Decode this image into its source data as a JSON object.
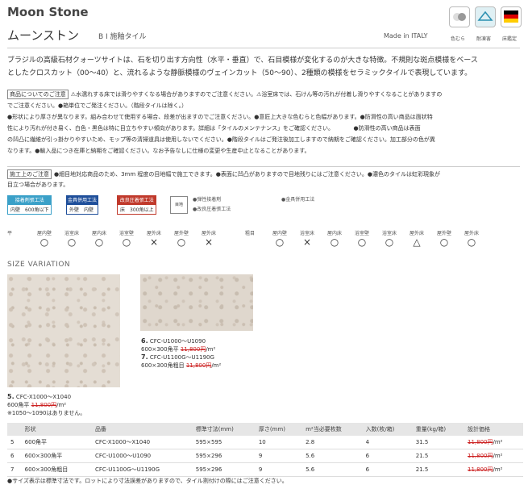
{
  "header": {
    "title": "Moon Stone",
    "subtitle": "ムーンストン",
    "series": "B I 施釉タイル",
    "made_in": "Made in ITALY",
    "badges": [
      {
        "icon": "color-variation-icon",
        "label": "色むら"
      },
      {
        "icon": "weather-resistant-icon",
        "label": "耐凍害"
      },
      {
        "icon": "german-flag-icon",
        "label": "床鑑定"
      }
    ]
  },
  "description": {
    "line1": "ブラジルの高級石材クォーツサイトは、石を切り出す方向性（水平・垂直）で、石目模様が変化するのが大きな特徴。不規則な斑点模様をベース",
    "line2": "としたクロスカット（00～40）と、流れるような静脈模様のヴェインカット（50～90）、2種類の模様をセラミックタイルで表現しています。"
  },
  "notes": {
    "heading": "商品についてのご注意",
    "lines": [
      "⚠水濡れする床では滑りやすくなる場合がありますのでご注意ください。⚠浴室床では、石けん等の汚れが付着し滑りやすくなることがありますの",
      "でご注意ください。●箱単位でご発注ください。（階段タイルは除く。）",
      "●形状により厚さが異なります。組み合わせて使用する場合、段差が出ますのでご注意ください。●意匠上大きな色むらと色幅があります。●防滑性の高い商品は面状特",
      "性により汚れが付き易く、白色・黒色は特に目立ちやすい傾向があります。詳細は「タイルのメンテナンス」をご確認ください。　　　　●防滑性の高い商品は表面",
      "の凹凸に繊維が引っ掛かりやすいため、モップ等の清掃道具は使用しないでください。●階段タイルはご発注後加工しますので納期をご確認ください。加工部分の色が異",
      "なります。●輸入品につき在庫と納期をご確認ください。なお予告なしに仕様の変更や生産中止となることがあります。"
    ]
  },
  "construction": {
    "heading": "施工上のご注意",
    "lines": [
      "●細目地対応商品のため、3mm 程度の目地幅で施工できます。●表面に凹凸がありますので目地残りにはご注意ください。●濃色のタイルは虹彩現象が",
      "目立つ場合があります。"
    ]
  },
  "methods": [
    {
      "head": "接着剤張工法",
      "left": "内壁",
      "right": "600角以下",
      "color": "#3aa0c8"
    },
    {
      "head": "金具併用工法",
      "left": "外壁",
      "right": "内壁",
      "color": "#1f4f9a"
    },
    {
      "head": "改良圧着張工法",
      "left": "床",
      "right": "300角以上",
      "color": "#c0392b"
    }
  ],
  "method_icon_label": "目地",
  "method_options": [
    "●弾性接着剤",
    "●改良圧着張工法",
    "●金具併用工法"
  ],
  "usage": {
    "row_label_a": "平",
    "row_label_b": "粗目",
    "headers": [
      "屋内壁",
      "浴室床",
      "屋内床",
      "浴室壁",
      "屋外床",
      "屋外壁",
      "屋外床"
    ],
    "marks_a": [
      "○",
      "○",
      "○",
      "○",
      "×",
      "○",
      "×"
    ],
    "headers_b": [
      "屋内壁",
      "浴室床",
      "屋内床",
      "浴室壁",
      "浴室床",
      "屋外床",
      "屋外壁",
      "屋外床"
    ],
    "marks_b": [
      "○",
      "×",
      "○",
      "○",
      "○",
      "△",
      "○",
      "○"
    ]
  },
  "size_variation": {
    "heading": "SIZE VARIATION",
    "item5": {
      "num": "5.",
      "code": "CFC-X1000～X1040",
      "size": "600角平",
      "price": "11,800円",
      "unit": "/m²",
      "note": "※1050～1090はありません。"
    },
    "item6": {
      "num": "6.",
      "code": "CFC-U1000～U1090",
      "size": "600×300角平",
      "price": "11,800円",
      "unit": "/m²"
    },
    "item7": {
      "num": "7.",
      "code": "CFC-U1100G～U1190G",
      "size": "600×300角粗目",
      "price": "11,800円",
      "unit": "/m²"
    }
  },
  "table": {
    "headers": [
      "",
      "形状",
      "品番",
      "標準寸法(mm)",
      "厚さ(mm)",
      "m²当必要枚数",
      "入数(枚/箱)",
      "重量(kg/箱)",
      "設計価格"
    ],
    "rows": [
      [
        "5",
        "600角平",
        "CFC-X1000～X1040",
        "595×595",
        "10",
        "2.8",
        "4",
        "31.5",
        "11,800円",
        "/m²"
      ],
      [
        "6",
        "600×300角平",
        "CFC-U1000～U1090",
        "595×296",
        "9",
        "5.6",
        "6",
        "21.5",
        "11,800円",
        "/m²"
      ],
      [
        "7",
        "600×300角粗目",
        "CFC-U1100G～U1190G",
        "595×296",
        "9",
        "5.6",
        "6",
        "21.5",
        "11,800円",
        "/m²"
      ]
    ]
  },
  "footnote": "●サイズ表示は標準寸法です。ロットにより寸法誤差がありますので、タイル割付けの際にはご注意ください。"
}
